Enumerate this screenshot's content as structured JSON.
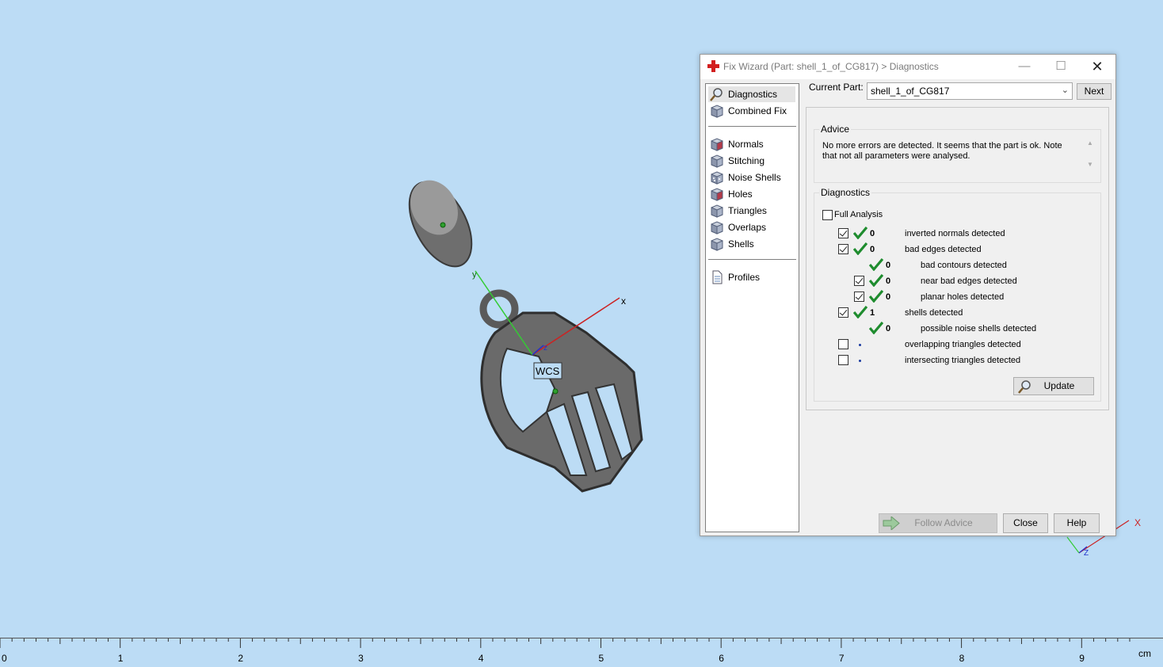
{
  "viewport": {
    "wcs_label": "WCS",
    "axis_x_label": "x",
    "axis_y_label": "y",
    "axis_z_label": "z",
    "corner_axis_x_label": "X",
    "corner_axis_z_label": "Z",
    "background_color": "#bcdcf5"
  },
  "ruler": {
    "labels": [
      "0",
      "1",
      "2",
      "3",
      "4",
      "5",
      "6",
      "7",
      "8",
      "9"
    ],
    "unit": "cm"
  },
  "wizard": {
    "title": "Fix Wizard (Part: shell_1_of_CG817) > Diagnostics",
    "nav": {
      "top": [
        {
          "label": "Diagnostics",
          "icon": "magnifier-icon",
          "selected": true
        },
        {
          "label": "Combined Fix",
          "icon": "cube-icon"
        }
      ],
      "fixes": [
        {
          "label": "Normals",
          "icon": "normals-cube-icon"
        },
        {
          "label": "Stitching",
          "icon": "stitching-cube-icon"
        },
        {
          "label": "Noise Shells",
          "icon": "noise-shells-cube-icon"
        },
        {
          "label": "Holes",
          "icon": "holes-cube-icon"
        },
        {
          "label": "Triangles",
          "icon": "triangles-cube-icon"
        },
        {
          "label": "Overlaps",
          "icon": "overlaps-cube-icon"
        },
        {
          "label": "Shells",
          "icon": "shells-cube-icon"
        }
      ],
      "bottom": [
        {
          "label": "Profiles",
          "icon": "document-icon"
        }
      ]
    },
    "current_part_label": "Current Part:",
    "current_part_value": "shell_1_of_CG817",
    "next_label": "Next",
    "advice": {
      "title": "Advice",
      "text": "No more errors are detected. It seems that the part is ok. Note that not all parameters were analysed."
    },
    "diagnostics": {
      "title": "Diagnostics",
      "full_analysis_label": "Full Analysis",
      "full_analysis_checked": false,
      "rows": [
        {
          "checked": true,
          "status": "ok",
          "count": "0",
          "label": "inverted normals detected",
          "indent": 0
        },
        {
          "checked": true,
          "status": "ok",
          "count": "0",
          "label": "bad edges detected",
          "indent": 0
        },
        {
          "checked": null,
          "status": "ok",
          "count": "0",
          "label": "bad contours detected",
          "indent": 1
        },
        {
          "checked": true,
          "status": "ok",
          "count": "0",
          "label": "near bad edges detected",
          "indent": 1
        },
        {
          "checked": true,
          "status": "ok",
          "count": "0",
          "label": "planar holes detected",
          "indent": 1
        },
        {
          "checked": true,
          "status": "ok",
          "count": "1",
          "label": "shells detected",
          "indent": 0
        },
        {
          "checked": null,
          "status": "ok",
          "count": "0",
          "label": "possible noise shells detected",
          "indent": 1
        },
        {
          "checked": false,
          "status": "pending",
          "count": "",
          "label": "overlapping triangles detected",
          "indent": 0
        },
        {
          "checked": false,
          "status": "pending",
          "count": "",
          "label": "intersecting triangles detected",
          "indent": 0
        }
      ],
      "update_label": "Update"
    },
    "follow_advice_label": "Follow Advice",
    "close_label": "Close",
    "help_label": "Help"
  }
}
